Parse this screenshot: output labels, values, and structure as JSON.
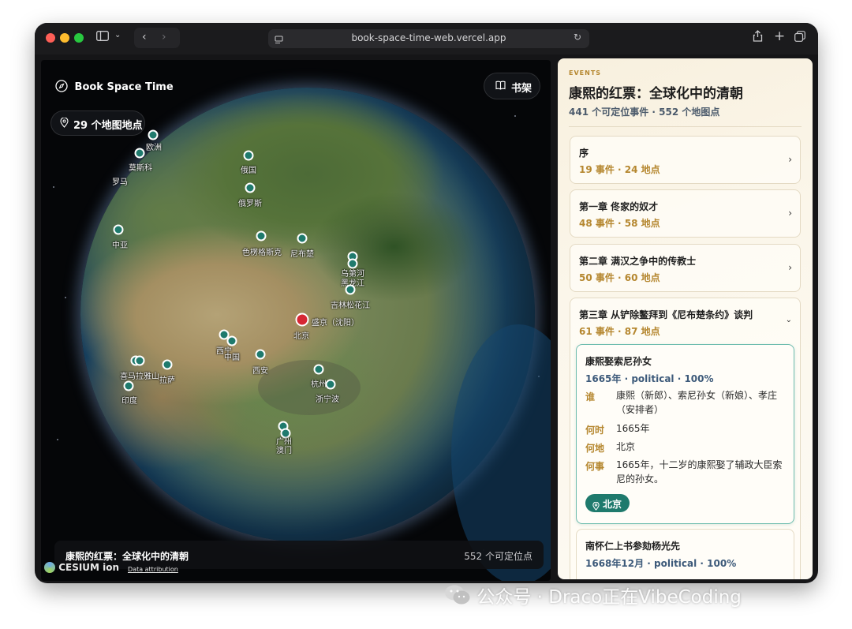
{
  "browser": {
    "url": "book-space-time-web.vercel.app"
  },
  "map": {
    "brand": "Book Space Time",
    "bookshelf_label": "书架",
    "places_count_label": "29 个地图地点",
    "bottom_title": "康熙的红票：全球化中的清朝",
    "bottom_count": "552 个可定位点",
    "cesium_logo": "CESIUM ion",
    "attribution": "Data attribution",
    "markers": [
      {
        "label": "欧洲"
      },
      {
        "label": "莫斯科"
      },
      {
        "label": "罗马"
      },
      {
        "label": "俄国"
      },
      {
        "label": "俄罗斯"
      },
      {
        "label": "中亚"
      },
      {
        "label": "色楞格斯克"
      },
      {
        "label": "尼布楚"
      },
      {
        "label": "乌第河"
      },
      {
        "label": "黑龙江"
      },
      {
        "label": "吉林松花江"
      },
      {
        "label": "盛京（沈阳）"
      },
      {
        "label": "北京"
      },
      {
        "label": "西宁"
      },
      {
        "label": "中国"
      },
      {
        "label": "西安"
      },
      {
        "label": "喜马拉雅山"
      },
      {
        "label": "拉萨"
      },
      {
        "label": "印度"
      },
      {
        "label": "杭州"
      },
      {
        "label": "浙宁波"
      },
      {
        "label": "广州"
      },
      {
        "label": "澳门"
      }
    ]
  },
  "panel": {
    "eyebrow": "EVENTS",
    "title": "康熙的红票：全球化中的清朝",
    "stats": "441 个可定位事件 · 552 个地图点",
    "chapters": [
      {
        "title": "序",
        "meta": "19 事件 · 24 地点"
      },
      {
        "title": "第一章 佟家的奴才",
        "meta": "48 事件 · 58 地点"
      },
      {
        "title": "第二章 满汉之争中的传教士",
        "meta": "50 事件 · 60 地点"
      },
      {
        "title": "第三章 从铲除鳌拜到《尼布楚条约》谈判",
        "meta": "61 事件 · 87 地点"
      }
    ],
    "event": {
      "title": "康熙娶索尼孙女",
      "meta": "1665年 · political · 100%",
      "who_label": "谁",
      "who": "康熙（新郎）、索尼孙女（新娘）、孝庄（安排者）",
      "when_label": "何时",
      "when": "1665年",
      "where_label": "何地",
      "where": "北京",
      "what_label": "何事",
      "what": "1665年，十二岁的康熙娶了辅政大臣索尼的孙女。",
      "place_button": "北京"
    },
    "next_event": {
      "title": "南怀仁上书参劾杨光先",
      "meta": "1668年12月 · political · 100%"
    }
  },
  "watermark": "公众号 · Draco正在VibeCoding"
}
